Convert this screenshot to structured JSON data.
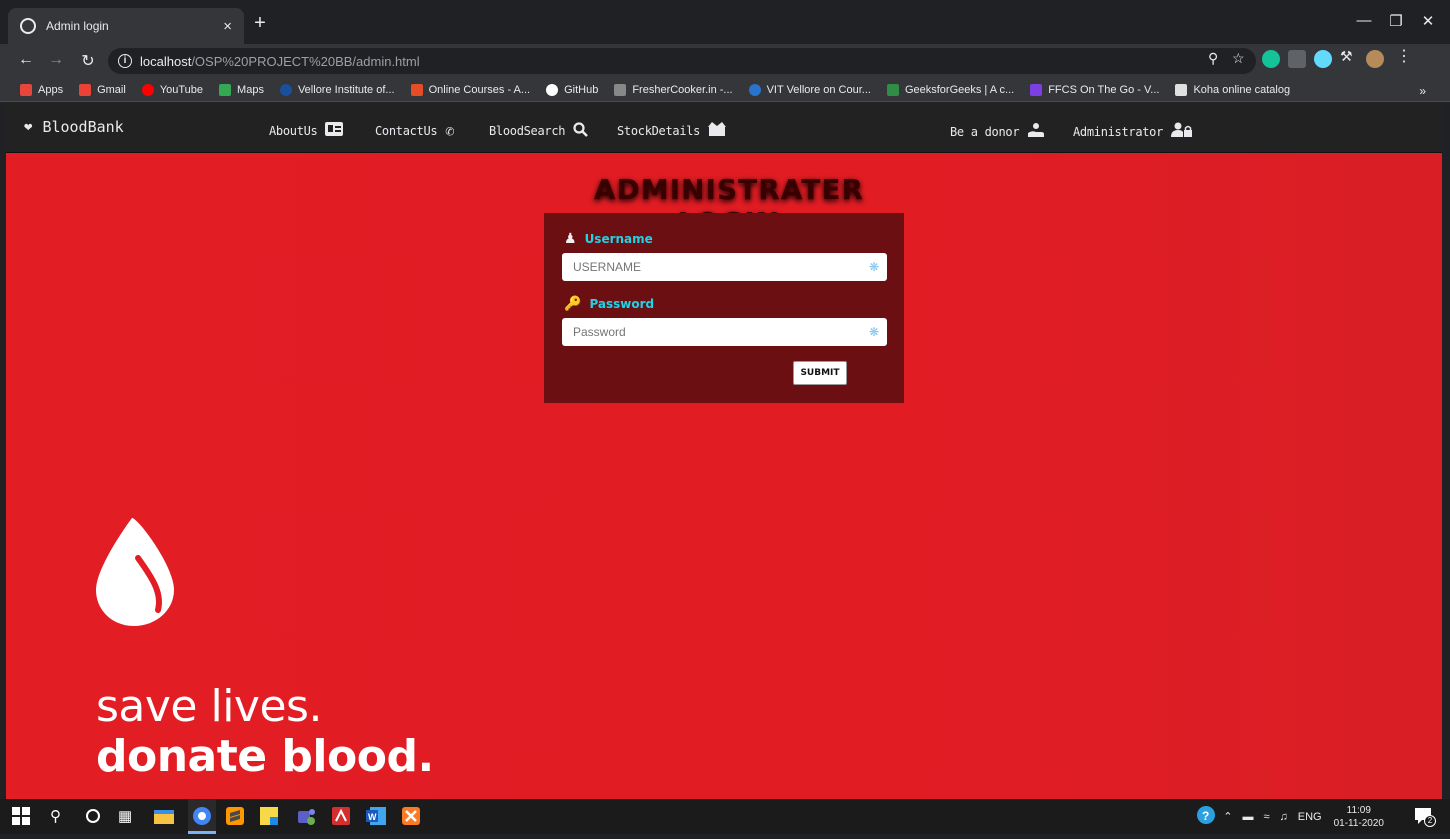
{
  "browser": {
    "tab_title": "Admin login",
    "tab_close": "×",
    "new_tab": "+",
    "url_host": "localhost",
    "url_path": "/OSP%20PROJECT%20BB/admin.html",
    "bookmarks": [
      {
        "label": "Apps",
        "color": "#e8453c"
      },
      {
        "label": "Gmail",
        "color": "#ea4335"
      },
      {
        "label": "YouTube",
        "color": "#ff0000"
      },
      {
        "label": "Maps",
        "color": "#34a853"
      },
      {
        "label": "Vellore Institute of...",
        "color": "#1a4f9c"
      },
      {
        "label": "Online Courses - A...",
        "color": "#e44d26"
      },
      {
        "label": "GitHub",
        "color": "#ffffff"
      },
      {
        "label": "FresherCooker.in -...",
        "color": "#888888"
      },
      {
        "label": "VIT Vellore on Cour...",
        "color": "#2a73cc"
      },
      {
        "label": "GeeksforGeeks | A c...",
        "color": "#2f8d46"
      },
      {
        "label": "FFCS On The Go - V...",
        "color": "#7b3fe4"
      },
      {
        "label": "Koha online catalog",
        "color": "#e0e0e0"
      }
    ],
    "bookmarks_more": "»"
  },
  "site": {
    "brand": "BloodBank",
    "nav": {
      "about": "AboutUs",
      "contact": "ContactUs",
      "search": "BloodSearch",
      "stock": "StockDetails",
      "donor": "Be a donor",
      "admin": "Administrator"
    }
  },
  "login": {
    "title": "ADMINISTRATER LOGIN",
    "username_label": "Username",
    "username_placeholder": "USERNAME",
    "password_label": "Password",
    "password_placeholder": "Password",
    "submit_label": "SUBMIT"
  },
  "hero": {
    "line1": "save lives.",
    "line2": "donate blood."
  },
  "taskbar": {
    "lang": "ENG",
    "time": "11:09",
    "date": "01-11-2020",
    "notifications": "2"
  },
  "colors": {
    "page_red": "#e31d24",
    "login_panel": "#6b0f12",
    "label_cyan": "#20d4e8",
    "nav_bg": "#222222"
  }
}
